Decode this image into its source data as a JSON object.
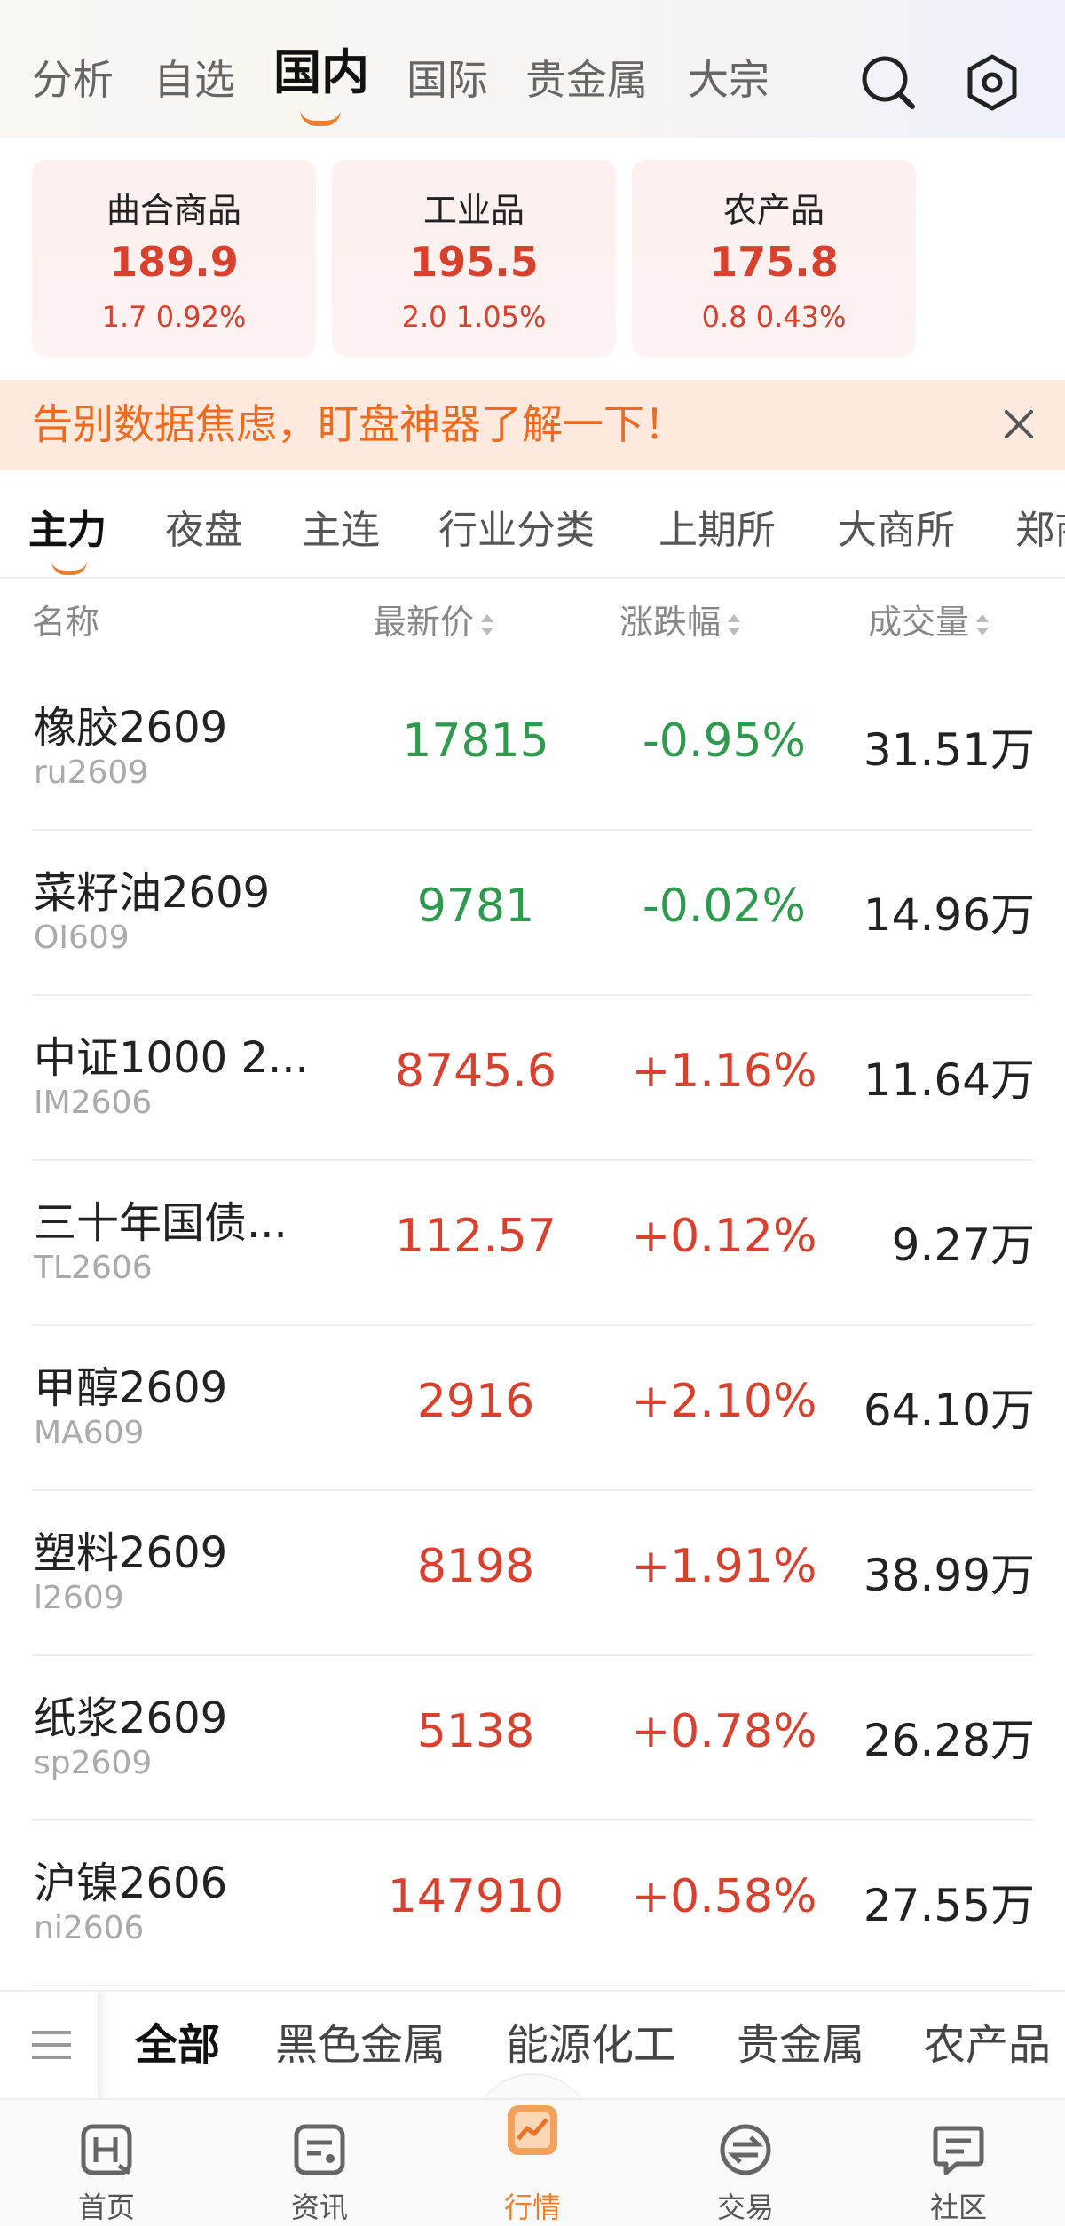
{
  "top_tabs": [
    "分析",
    "自选",
    "国内",
    "国际",
    "贵金属",
    "大宗"
  ],
  "active_top_tab": "国内",
  "index_cards": [
    {
      "name": "曲合商品",
      "value": "189.9",
      "change": "1.7  0.92%"
    },
    {
      "name": "工业品",
      "value": "195.5",
      "change": "2.0  1.05%"
    },
    {
      "name": "农产品",
      "value": "175.8",
      "change": "0.8  0.43%"
    }
  ],
  "banner": {
    "text": "告别数据焦虑，盯盘神器了解一下！"
  },
  "category_tabs": [
    "主力",
    "夜盘",
    "主连",
    "行业分类",
    "上期所",
    "大商所",
    "郑商"
  ],
  "columns": {
    "name": "名称",
    "price": "最新价",
    "change": "涨跌幅",
    "volume": "成交量"
  },
  "rows": [
    {
      "name": "橡胶2609",
      "code": "ru2609",
      "price": "17815",
      "pct": "-0.95%",
      "volume": "31.51万",
      "dir": "down"
    },
    {
      "name": "菜籽油2609",
      "code": "OI609",
      "price": "9781",
      "pct": "-0.02%",
      "volume": "14.96万",
      "dir": "down"
    },
    {
      "name": "中证1000 2...",
      "code": "IM2606",
      "price": "8745.6",
      "pct": "+1.16%",
      "volume": "11.64万",
      "dir": "up"
    },
    {
      "name": "三十年国债...",
      "code": "TL2606",
      "price": "112.57",
      "pct": "+0.12%",
      "volume": "9.27万",
      "dir": "up"
    },
    {
      "name": "甲醇2609",
      "code": "MA609",
      "price": "2916",
      "pct": "+2.10%",
      "volume": "64.10万",
      "dir": "up"
    },
    {
      "name": "塑料2609",
      "code": "l2609",
      "price": "8198",
      "pct": "+1.91%",
      "volume": "38.99万",
      "dir": "up"
    },
    {
      "name": "纸浆2609",
      "code": "sp2609",
      "price": "5138",
      "pct": "+0.78%",
      "volume": "26.28万",
      "dir": "up"
    },
    {
      "name": "沪镍2606",
      "code": "ni2606",
      "price": "147910",
      "pct": "+0.58%",
      "volume": "27.55万",
      "dir": "up"
    }
  ],
  "sector_tabs": [
    "全部",
    "黑色金属",
    "能源化工",
    "贵金属",
    "农产品"
  ],
  "bottom_nav": [
    "首页",
    "资讯",
    "行情",
    "交易",
    "社区"
  ],
  "colors": {
    "up": "#d8412e",
    "down": "#2f9a4d",
    "accent": "#f07d2c"
  }
}
